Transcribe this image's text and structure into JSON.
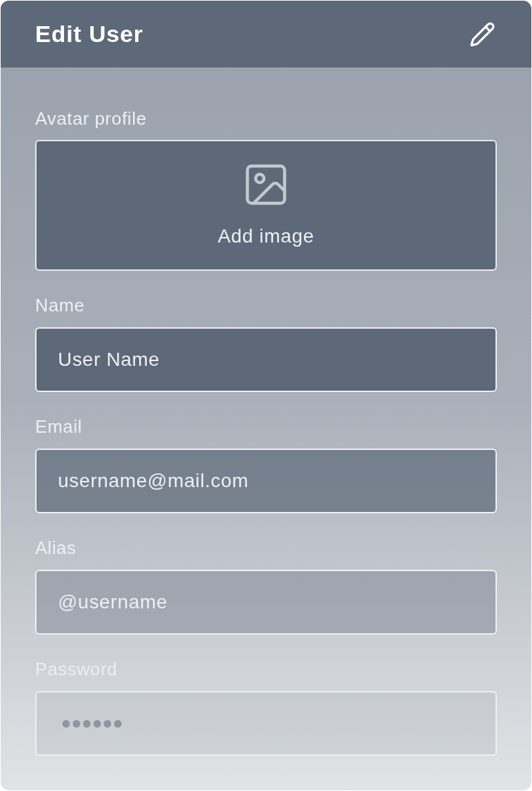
{
  "header": {
    "title": "Edit User"
  },
  "avatar": {
    "label": "Avatar profile",
    "button": "Add image"
  },
  "fields": [
    {
      "label": "Name",
      "value": "User Name",
      "disabled": false
    },
    {
      "label": "Email",
      "value": "username@mail.com",
      "disabled": false
    },
    {
      "label": "Alias",
      "value": "@username",
      "disabled": false
    },
    {
      "label": "Password",
      "value": "••••••",
      "disabled": true
    }
  ]
}
